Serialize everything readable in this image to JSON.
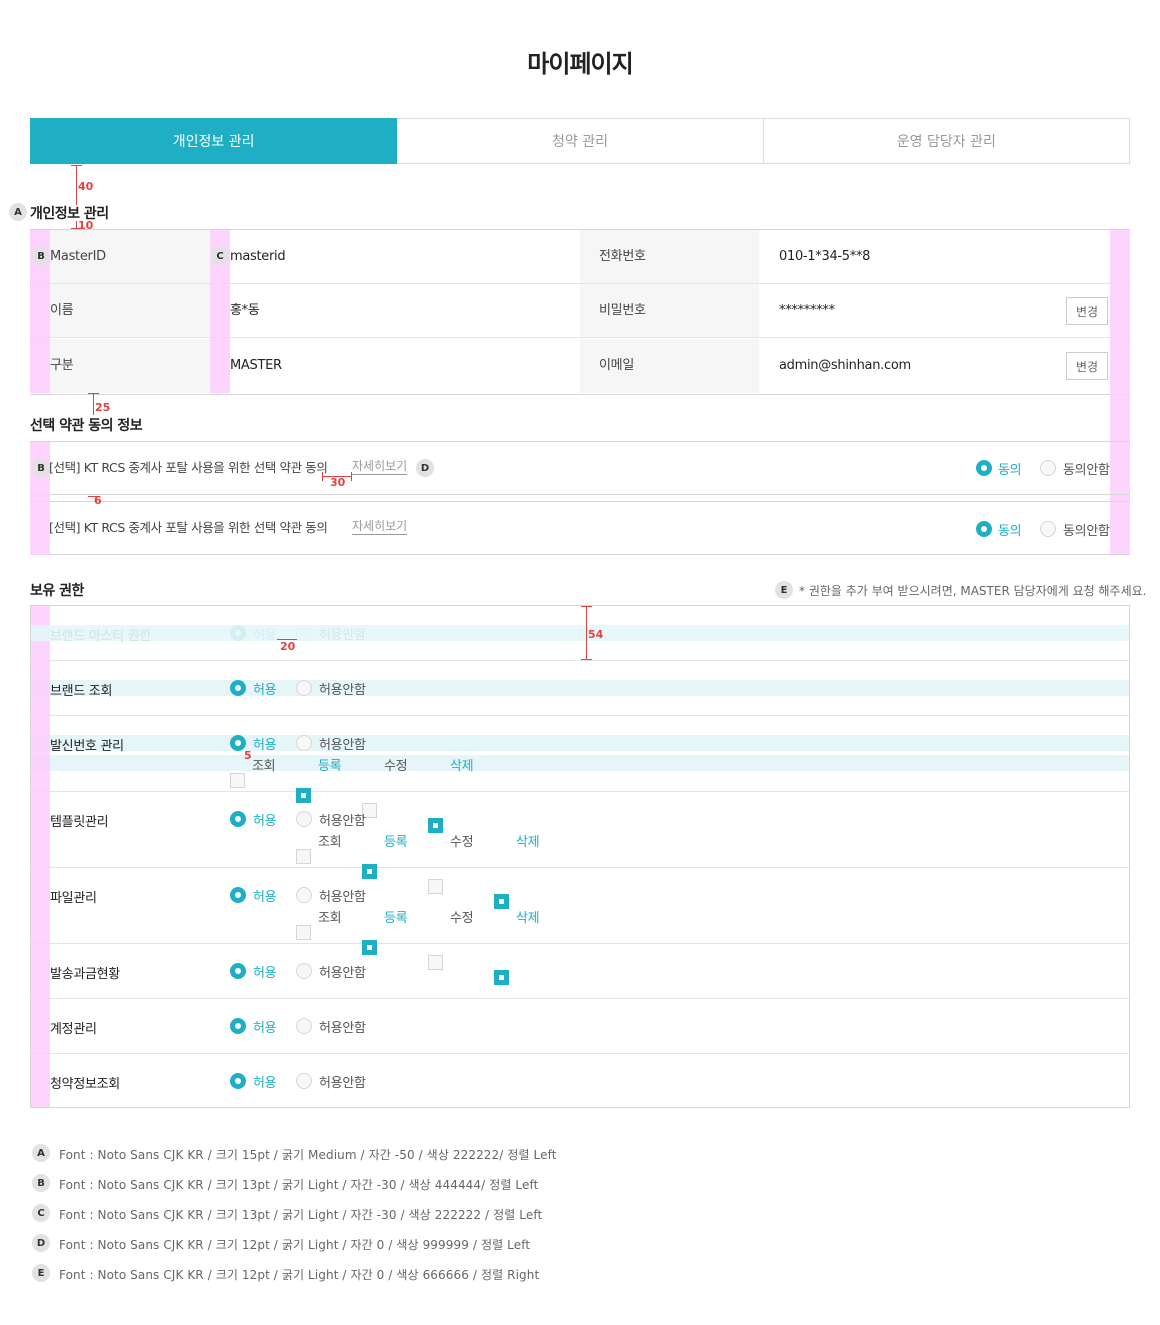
{
  "page_title": "마이페이지",
  "tabs": [
    {
      "label": "개인정보 관리",
      "active": true
    },
    {
      "label": "청약 관리",
      "active": false
    },
    {
      "label": "운영 담당자 관리",
      "active": false
    }
  ],
  "section_personal": {
    "title": "개인정보 관리",
    "marker": "A"
  },
  "info": {
    "rows": [
      {
        "label1": "MasterID",
        "value1": "masterid",
        "label2": "전화번호",
        "value2": "010-1*34-5**8",
        "button": ""
      },
      {
        "label1": "이름",
        "value1": "홍*동",
        "label2": "비밀번호",
        "value2": "*********",
        "button": "변경"
      },
      {
        "label1": "구분",
        "value1": "MASTER",
        "label2": "이메일",
        "value2": "admin@shinhan.com",
        "button": "변경"
      }
    ],
    "marker_b": "B",
    "marker_c": "C"
  },
  "section_consent": {
    "title": "선택 약관 동의 정보"
  },
  "consents": [
    {
      "text": "[선택] KT RCS 중계사 포탈 사용을 위한 선택 약관 동의",
      "detail": "자세히보기",
      "agree": "동의",
      "disagree": "동의안함",
      "marker": "D"
    },
    {
      "text": "[선택] KT RCS 중계사 포탈 사용을 위한 선택 약관 동의",
      "detail": "자세히보기",
      "agree": "동의",
      "disagree": "동의안함",
      "marker": ""
    }
  ],
  "section_perm": {
    "title": "보유 권한",
    "note_marker": "E",
    "note": "* 권한을 추가 부여 받으시려면, MASTER 담당자에게 요청 해주세요."
  },
  "permission_options": {
    "allow": "허용",
    "deny": "허용안함",
    "view": "조회",
    "register": "등록",
    "edit": "수정",
    "delete": "삭제"
  },
  "permissions": [
    {
      "name": "브랜드 마스터 권한",
      "allow": true,
      "checks": null
    },
    {
      "name": "브랜드 조회",
      "allow": true,
      "checks": null
    },
    {
      "name": "발신번호 관리",
      "allow": true,
      "checks": {
        "view": false,
        "register": true,
        "edit": false,
        "delete": true
      }
    },
    {
      "name": "템플릿관리",
      "allow": true,
      "checks": {
        "view": false,
        "register": true,
        "edit": false,
        "delete": true
      }
    },
    {
      "name": "파일관리",
      "allow": true,
      "checks": {
        "view": false,
        "register": true,
        "edit": false,
        "delete": true
      }
    },
    {
      "name": "발송과금현황",
      "allow": true,
      "checks": null
    },
    {
      "name": "계정관리",
      "allow": true,
      "checks": null
    },
    {
      "name": "청약정보조회",
      "allow": true,
      "checks": null
    }
  ],
  "guides": {
    "g40": "40",
    "g10": "10",
    "g25": "25",
    "g30": "30",
    "g6": "6",
    "g54": "54",
    "g20": "20",
    "g5": "5"
  },
  "specs": [
    {
      "marker": "A",
      "text": "Font : Noto Sans CJK KR / 크기 15pt / 굵기 Medium / 자간 -50 / 색상 222222/ 정렬 Left"
    },
    {
      "marker": "B",
      "text": "Font : Noto Sans CJK KR / 크기 13pt / 굵기 Light / 자간 -30 / 색상 444444/ 정렬 Left"
    },
    {
      "marker": "C",
      "text": "Font : Noto Sans CJK KR / 크기 13pt / 굵기 Light / 자간 -30 / 색상 222222 / 정렬 Left"
    },
    {
      "marker": "D",
      "text": "Font : Noto Sans CJK KR / 크기 12pt / 굵기 Light / 자간 0 / 색상 999999 / 정렬 Left"
    },
    {
      "marker": "E",
      "text": "Font : Noto Sans CJK KR / 크기 12pt / 굵기 Light / 자간 0 / 색상 666666 / 정렬 Right"
    }
  ],
  "colors": {
    "accent": "#1eafc5",
    "guide": "#e34242",
    "guide_band": "#fccdfd"
  }
}
